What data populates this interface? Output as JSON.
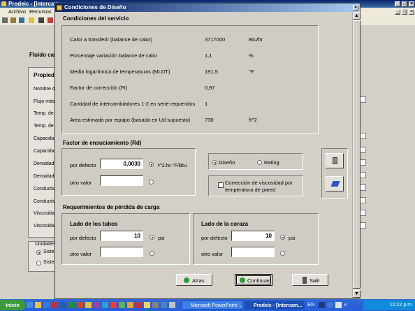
{
  "background_app": {
    "title": "Prodeic - [Intercam",
    "menu": [
      "Archivo",
      "Recursos"
    ],
    "section_title": "Fluido cali",
    "panel_title": "Propieda",
    "row_labels": [
      "Nombre d",
      "Flujo mási",
      "Temp. de",
      "Temp. de s",
      "Capacidad",
      "Capacidad",
      "Densidad (",
      "Densidad (",
      "Conductivi",
      "Conductivi",
      "Viscosidad",
      "Viscosidad"
    ],
    "units_label": "Unidades",
    "units_options": [
      "Sister",
      "Sister"
    ]
  },
  "dialog": {
    "title": "Condiciones de Diseño",
    "service": {
      "title": "Condiciones del servicio",
      "rows": [
        {
          "label": "Calor a transferir (balance de calor)",
          "value": "3717000",
          "unit": "Btu/hr"
        },
        {
          "label": "Porcentaje variación balance de calor",
          "value": "1,1",
          "unit": "%"
        },
        {
          "label": "Media logarítmica de temperaturas (MLDT)",
          "value": "191,5",
          "unit": "°F"
        },
        {
          "label": "Factor de corrección (Ft)",
          "value": "0,97",
          "unit": ""
        },
        {
          "label": "Cantidad de intercambiadores 1-2 en serie requeridos",
          "value": "1",
          "unit": ""
        },
        {
          "label": "Area estimada por equipo (basada en Ud supuesto)",
          "value": "730",
          "unit": "ft^2"
        }
      ]
    },
    "fouling": {
      "title": "Factor de ensuciamiento (Rd)",
      "default_label": "por defecto",
      "default_value": "0,0030",
      "unit": "t^2.hr.°F/Btu",
      "other_label": "otro valor",
      "other_value": ""
    },
    "mode": {
      "diseno": "Diseño",
      "rating": "Rating"
    },
    "viscosity_correction": "Corrección de viscosidad por temperatura de pared",
    "pressure": {
      "title": "Requerimientos de pérdida de carga",
      "tubes": {
        "title": "Lado de los tubos",
        "default_label": "por defecto",
        "default_value": "10",
        "unit": "psi",
        "other_label": "otro valor",
        "other_value": ""
      },
      "shell": {
        "title": "Lado de la coraza",
        "default_label": "por defecto",
        "default_value": "10",
        "unit": "psi",
        "other_label": "otro valor",
        "other_value": ""
      }
    },
    "buttons": {
      "back": "Atras",
      "continue": "Continuar",
      "exit": "Salir"
    }
  },
  "taskbar": {
    "start": "Inicio",
    "tasks": [
      "Microsoft PowerPoint -...",
      "Prodeic - [Intercam..."
    ],
    "lang": "EN",
    "time": "10:22 p.m."
  },
  "colors": {
    "titlebar": "#0a246a",
    "dialog_bg": "#d4d0c8",
    "taskbar": "#245edb"
  }
}
